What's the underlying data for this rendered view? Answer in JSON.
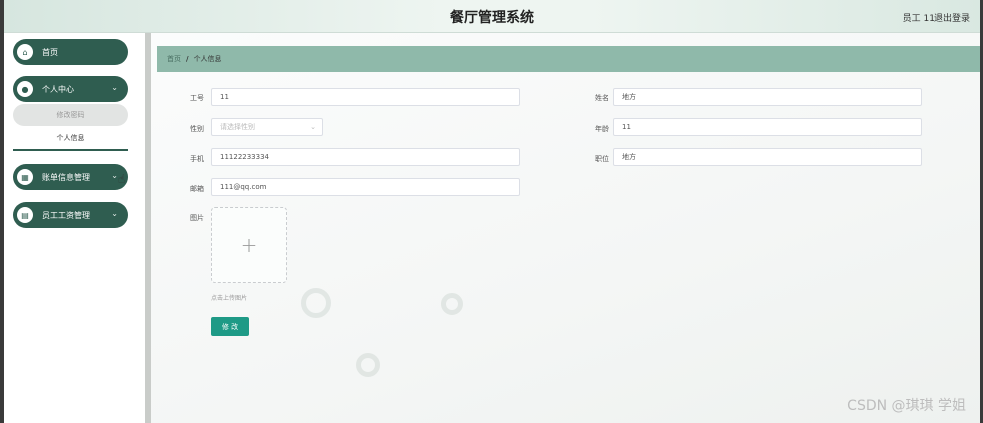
{
  "header": {
    "title": "餐厅管理系统",
    "user": "员工 11",
    "logout": "退出登录"
  },
  "sidebar": {
    "items": [
      {
        "label": "首页",
        "icon": "home-icon"
      },
      {
        "label": "个人中心",
        "icon": "user-icon"
      },
      {
        "label": "账单信息管理",
        "icon": "grid-icon"
      },
      {
        "label": "员工工资管理",
        "icon": "list-icon"
      }
    ],
    "sub_items": {
      "change_password": "修改密码",
      "personal_info": "个人信息"
    }
  },
  "breadcrumb": {
    "home": "首页",
    "separator": "/",
    "current": "个人信息"
  },
  "form": {
    "job_no": {
      "label": "工号",
      "value": "11"
    },
    "name": {
      "label": "姓名",
      "value": "地方"
    },
    "gender": {
      "label": "性别",
      "placeholder": "请选择性别"
    },
    "age": {
      "label": "年龄",
      "value": "11"
    },
    "phone": {
      "label": "手机",
      "value": "11122233334"
    },
    "position": {
      "label": "职位",
      "value": "地方"
    },
    "email": {
      "label": "邮箱",
      "value": "111@qq.com"
    },
    "image": {
      "label": "图片",
      "tip": "点击上传图片"
    },
    "submit": "修 改"
  },
  "watermark": "CSDN @琪琪 学姐",
  "colors": {
    "accent": "#2f5d50",
    "breadcrumb_bg": "#8fb9aa",
    "button": "#1e9a86"
  }
}
